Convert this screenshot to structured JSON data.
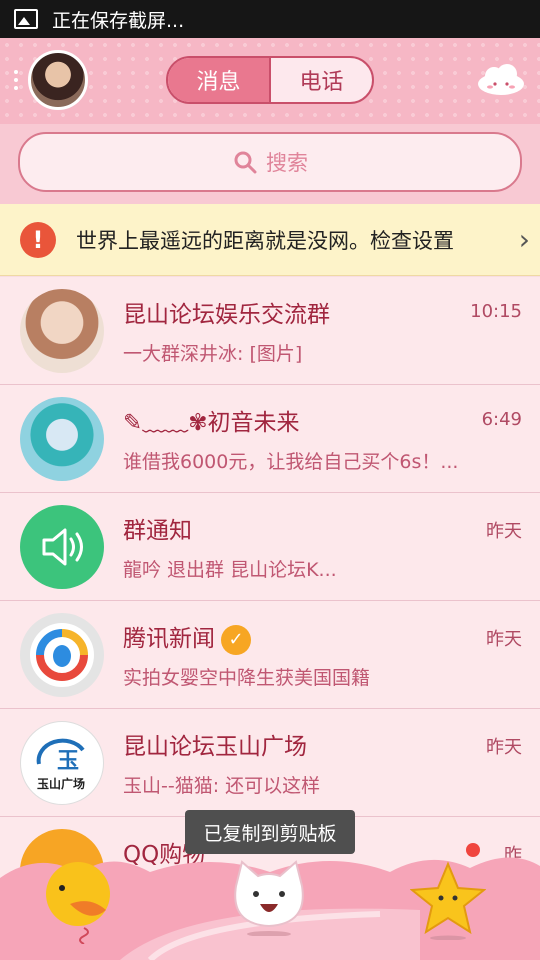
{
  "status_bar": {
    "text": "正在保存截屏..."
  },
  "header": {
    "tabs": [
      {
        "label": "消息",
        "active": true
      },
      {
        "label": "电话",
        "active": false
      }
    ],
    "icons": {
      "menu": "menu-dots-icon",
      "avatar": "user-avatar",
      "cloud": "cloud-icon"
    }
  },
  "search": {
    "placeholder": "搜索",
    "icon": "search-icon"
  },
  "notice": {
    "text": "世界上最遥远的距离就是没网。检查设置",
    "icon": "warning-icon",
    "chevron": "›"
  },
  "conversations": [
    {
      "name": "昆山论坛娱乐交流群",
      "time": "10:15",
      "message": "一大群深井冰: [图片]"
    },
    {
      "name": "✎﹏﹏✾初音未来",
      "time": "6:49",
      "message": "谁借我6000元，让我给自己买个6s！..."
    },
    {
      "name": "群通知",
      "time": "昨天",
      "message": "龍吟 退出群 昆山论坛K..."
    },
    {
      "name": "腾讯新闻",
      "time": "昨天",
      "message": "实拍女婴空中降生获美国国籍",
      "verified": true
    },
    {
      "name": "昆山论坛玉山广场",
      "time": "昨天",
      "message": "玉山--猫猫: 还可以这样",
      "avatar_text": "玉",
      "avatar_sub": "玉山广场"
    },
    {
      "name": "QQ购物",
      "time": "昨",
      "message": ""
    }
  ],
  "toast": {
    "text": "已复制到剪贴板"
  },
  "colors": {
    "accent": "#e9788f",
    "header_bg": "#f6b7c5",
    "name": "#a1263f",
    "notice_bg": "#fdf3c9"
  }
}
